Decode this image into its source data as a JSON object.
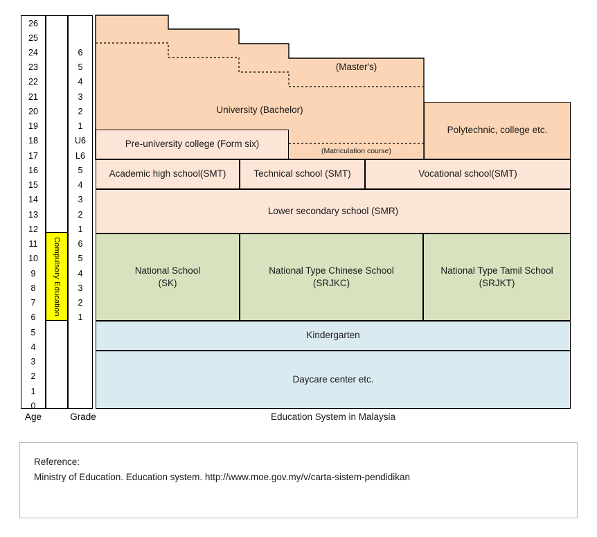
{
  "chart_data": {
    "type": "diagram",
    "title": "Education System in Malaysia",
    "axes": {
      "age_label": "Age",
      "grade_label": "Grade",
      "age_ticks": [
        "26",
        "25",
        "24",
        "23",
        "22",
        "21",
        "20",
        "19",
        "18",
        "17",
        "16",
        "15",
        "14",
        "13",
        "12",
        "11",
        "10",
        "9",
        "8",
        "7",
        "6",
        "5",
        "4",
        "3",
        "2",
        "1",
        "0"
      ],
      "age_range": [
        0,
        26
      ],
      "grade_ticks": [
        {
          "age": 24,
          "label": "6"
        },
        {
          "age": 23,
          "label": "5"
        },
        {
          "age": 22,
          "label": "4"
        },
        {
          "age": 21,
          "label": "3"
        },
        {
          "age": 20,
          "label": "2"
        },
        {
          "age": 19,
          "label": "1"
        },
        {
          "age": 18,
          "label": "U6"
        },
        {
          "age": 17,
          "label": "L6"
        },
        {
          "age": 16,
          "label": "5"
        },
        {
          "age": 15,
          "label": "4"
        },
        {
          "age": 14,
          "label": "3"
        },
        {
          "age": 13,
          "label": "2"
        },
        {
          "age": 12,
          "label": "1"
        },
        {
          "age": 11,
          "label": "6"
        },
        {
          "age": 10,
          "label": "5"
        },
        {
          "age": 9,
          "label": "4"
        },
        {
          "age": 8,
          "label": "3"
        },
        {
          "age": 7,
          "label": "2"
        },
        {
          "age": 6,
          "label": "1"
        }
      ]
    },
    "compulsory_band": {
      "label": "Compulsory Education",
      "age_start": 6,
      "age_end": 12,
      "color": "#ffff00"
    },
    "blocks": [
      {
        "id": "university",
        "label": "University (Bachelor)",
        "color": "#fbd5b5",
        "age_from": 18,
        "age_to": 26
      },
      {
        "id": "masters",
        "label": "(Master's)",
        "color": "#fbd5b5",
        "age_from": 22,
        "age_to": 25
      },
      {
        "id": "polytechnic",
        "label": "Polytechnic, college etc.",
        "color": "#fbd5b5",
        "age_from": 16,
        "age_to": 20
      },
      {
        "id": "preuni",
        "label": "Pre-university college (Form six)",
        "color": "#fce4d6",
        "age_from": 17,
        "age_to": 19
      },
      {
        "id": "matriculation",
        "label": "(Matriculation course)",
        "color": "#fce4d6",
        "age_from": 17,
        "age_to": 19
      },
      {
        "id": "academic",
        "label": "Academic high school(SMT)",
        "color": "#fce4d6",
        "age_from": 15,
        "age_to": 17
      },
      {
        "id": "technical",
        "label": "Technical school (SMT)",
        "color": "#fce4d6",
        "age_from": 15,
        "age_to": 17
      },
      {
        "id": "vocational",
        "label": "Vocational school(SMT)",
        "color": "#fce4d6",
        "age_from": 15,
        "age_to": 17
      },
      {
        "id": "smr",
        "label": "Lower secondary school (SMR)",
        "color": "#fce4d6",
        "age_from": 12,
        "age_to": 15
      },
      {
        "id": "sk",
        "label": "National School\n(SK)",
        "color": "#d9e2bf",
        "age_from": 6,
        "age_to": 12
      },
      {
        "id": "srjkc",
        "label": "National Type Chinese School\n(SRJKC)",
        "color": "#d9e2bf",
        "age_from": 6,
        "age_to": 12
      },
      {
        "id": "srjkt",
        "label": "National Type Tamil School\n(SRJKT)",
        "color": "#d9e2bf",
        "age_from": 6,
        "age_to": 12
      },
      {
        "id": "kindergarten",
        "label": "Kindergarten",
        "color": "#daeaf1",
        "age_from": 4,
        "age_to": 6
      },
      {
        "id": "daycare",
        "label": "Daycare center etc.",
        "color": "#daeaf1",
        "age_from": 0,
        "age_to": 4
      }
    ],
    "colors": {
      "tertiary": "#fbd5b5",
      "secondary": "#fce4d6",
      "primary": "#d9e2bf",
      "preschool": "#daeaf1",
      "compulsory": "#ffff00",
      "stroke": "#000000"
    }
  },
  "axis": {
    "age_caption": "Age",
    "grade_caption": "Grade",
    "ticks": {
      "a26": "26",
      "a25": "25",
      "a24": "24",
      "a23": "23",
      "a22": "22",
      "a21": "21",
      "a20": "20",
      "a19": "19",
      "a18": "18",
      "a17": "17",
      "a16": "16",
      "a15": "15",
      "a14": "14",
      "a13": "13",
      "a12": "12",
      "a11": "11",
      "a10": "10",
      "a9": "9",
      "a8": "8",
      "a7": "7",
      "a6": "6",
      "a5": "5",
      "a4": "4",
      "a3": "3",
      "a2": "2",
      "a1": "1",
      "a0": "0"
    },
    "grades": {
      "g24": "6",
      "g23": "5",
      "g22": "4",
      "g21": "3",
      "g20": "2",
      "g19": "1",
      "g18": "U6",
      "g17": "L6",
      "g16": "5",
      "g15": "4",
      "g14": "3",
      "g13": "2",
      "g12": "1",
      "g11": "6",
      "g10": "5",
      "g9": "4",
      "g8": "3",
      "g7": "2",
      "g6": "1"
    }
  },
  "compulsory": {
    "label": "Compulsory Education"
  },
  "labels": {
    "university": "University (Bachelor)",
    "masters": "(Master's)",
    "polytechnic": "Polytechnic, college etc.",
    "preuni": "Pre-university college (Form six)",
    "matriculation": "(Matriculation course)",
    "academic": "Academic high school(SMT)",
    "technical": "Technical school (SMT)",
    "vocational": "Vocational school(SMT)",
    "smr": "Lower secondary school (SMR)",
    "sk_line1": "National School",
    "sk_line2": "(SK)",
    "srjkc_line1": "National Type Chinese School",
    "srjkc_line2": "(SRJKC)",
    "srjkt_line1": "National Type Tamil School",
    "srjkt_line2": "(SRJKT)",
    "kindergarten": "Kindergarten",
    "daycare": "Daycare center etc."
  },
  "caption": {
    "title": "Education System in Malaysia"
  },
  "reference": {
    "heading": "Reference:",
    "citation": "Ministry of Education. Education  system. http://www.moe.gov.my/v/carta-sistem-pendidikan"
  }
}
